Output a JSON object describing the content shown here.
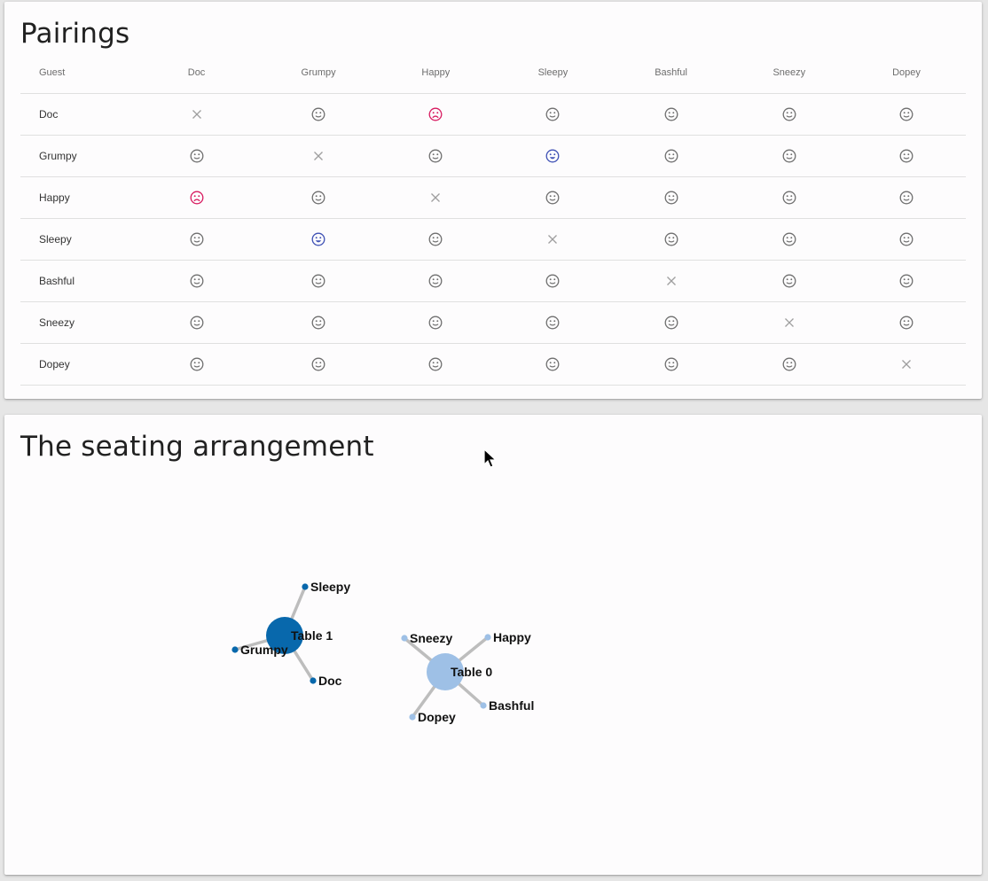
{
  "pairings": {
    "title": "Pairings",
    "guest_header": "Guest",
    "guests": [
      "Doc",
      "Grumpy",
      "Happy",
      "Sleepy",
      "Bashful",
      "Sneezy",
      "Dopey"
    ],
    "matrix": [
      [
        "x",
        "neutral",
        "sad",
        "neutral",
        "neutral",
        "neutral",
        "neutral"
      ],
      [
        "neutral",
        "x",
        "neutral",
        "happy",
        "neutral",
        "neutral",
        "neutral"
      ],
      [
        "sad",
        "neutral",
        "x",
        "neutral",
        "neutral",
        "neutral",
        "neutral"
      ],
      [
        "neutral",
        "happy",
        "neutral",
        "x",
        "neutral",
        "neutral",
        "neutral"
      ],
      [
        "neutral",
        "neutral",
        "neutral",
        "neutral",
        "x",
        "neutral",
        "neutral"
      ],
      [
        "neutral",
        "neutral",
        "neutral",
        "neutral",
        "neutral",
        "x",
        "neutral"
      ],
      [
        "neutral",
        "neutral",
        "neutral",
        "neutral",
        "neutral",
        "neutral",
        "x"
      ]
    ],
    "icon_names": {
      "x": "close-icon",
      "neutral": "neutral-face-icon",
      "sad": "sad-face-icon",
      "happy": "happy-face-icon"
    },
    "colors": {
      "neutral": "#6f6f6f",
      "sad": "#d81b60",
      "happy": "#3f51b5",
      "x": "#9e9e9e"
    }
  },
  "seating": {
    "title": "The seating arrangement",
    "tables": [
      {
        "label": "Table 1",
        "color": "#0868ac",
        "guests": [
          "Sleepy",
          "Grumpy",
          "Doc"
        ]
      },
      {
        "label": "Table 0",
        "color": "#9ec0e6",
        "guests": [
          "Sneezy",
          "Happy",
          "Bashful",
          "Dopey"
        ]
      }
    ]
  }
}
